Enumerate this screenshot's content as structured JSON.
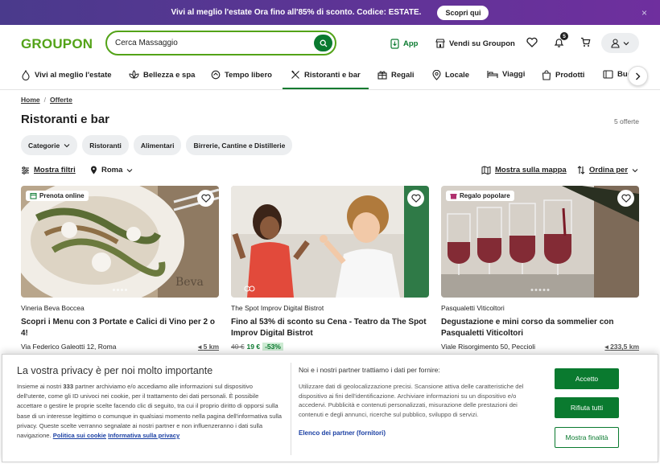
{
  "promo": {
    "text": "Vivi al meglio l'estate Ora fino all'85% di sconto. Codice: ESTATE.",
    "cta": "Scopri qui",
    "close": "×"
  },
  "header": {
    "logo": "GROUPON",
    "search_value": "Cerca Massaggio",
    "app": "App",
    "sell": "Vendi su Groupon",
    "notifications": "5"
  },
  "categories": [
    "Vivi al meglio l'estate",
    "Bellezza e spa",
    "Tempo libero",
    "Ristoranti e bar",
    "Regali",
    "Locale",
    "Viaggi",
    "Prodotti",
    "Buo"
  ],
  "breadcrumb": [
    "Home",
    "Offerte"
  ],
  "page": {
    "title": "Ristoranti e bar",
    "count": "5 offerte"
  },
  "chips": [
    "Categorie",
    "Ristoranti",
    "Alimentari",
    "Birrerie, Cantine e Distillerie"
  ],
  "filters": {
    "show": "Mostra filtri",
    "location": "Roma",
    "map": "Mostra sulla mappa",
    "sort": "Ordina per"
  },
  "cards": [
    {
      "tag": "Prenota online",
      "merchant": "Vineria Beva Boccea",
      "title": "Scopri i Menu con 3 Portate e Calici di Vino per 2 o 4!",
      "address": "Via Federico Galeotti 12, Roma",
      "distance": "5 km"
    },
    {
      "tag": "",
      "merchant": "The Spot Improv Digital Bistrot",
      "title": "Fino al 53% di sconto su Cena - Teatro da The Spot Improv Digital Bistrot",
      "old_price": "40 €",
      "new_price": "19 €",
      "discount": "-53%"
    },
    {
      "tag": "Regalo popolare",
      "merchant": "Pasqualetti Viticoltori",
      "title": "Degustazione e mini corso da sommelier con Pasqualetti Viticoltori",
      "address": "Viale Risorgimento 50, Peccioli",
      "distance": "233,5 km"
    }
  ],
  "consent": {
    "title": "La vostra privacy è per noi molto importante",
    "intro_a": "Insieme ai nostri ",
    "partners": "333",
    "intro_b": " partner archiviamo e/o accediamo alle informazioni sul dispositivo dell'utente, come gli ID univoci nei cookie, per il trattamento dei dati personali. È possibile accettare o gestire le proprie scelte facendo clic di seguito, tra cui il proprio diritto di opporsi sulla base di un interesse legittimo o comunque in qualsiasi momento nella pagina dell'informativa sulla privacy. Queste scelte verranno segnalate ai nostri partner e non influenzeranno i dati sulla navigazione. ",
    "cookie_link": "Politica sui cookie",
    "privacy_link": "Informativa sulla privacy",
    "right_title": "Noi e i nostri partner trattiamo i dati per fornire:",
    "right_text": "Utilizzare dati di geolocalizzazione precisi. Scansione attiva delle caratteristiche del dispositivo ai fini dell'identificazione. Archiviare informazioni su un dispositivo e/o accedervi. Pubblicità e contenuti personalizzati, misurazione delle prestazioni dei contenuti e degli annunci, ricerche sul pubblico, sviluppo di servizi.",
    "vendors": "Elenco dei partner (fornitori)",
    "accept": "Accetto",
    "reject": "Rifiuta tutti",
    "more": "Mostra finalità"
  }
}
